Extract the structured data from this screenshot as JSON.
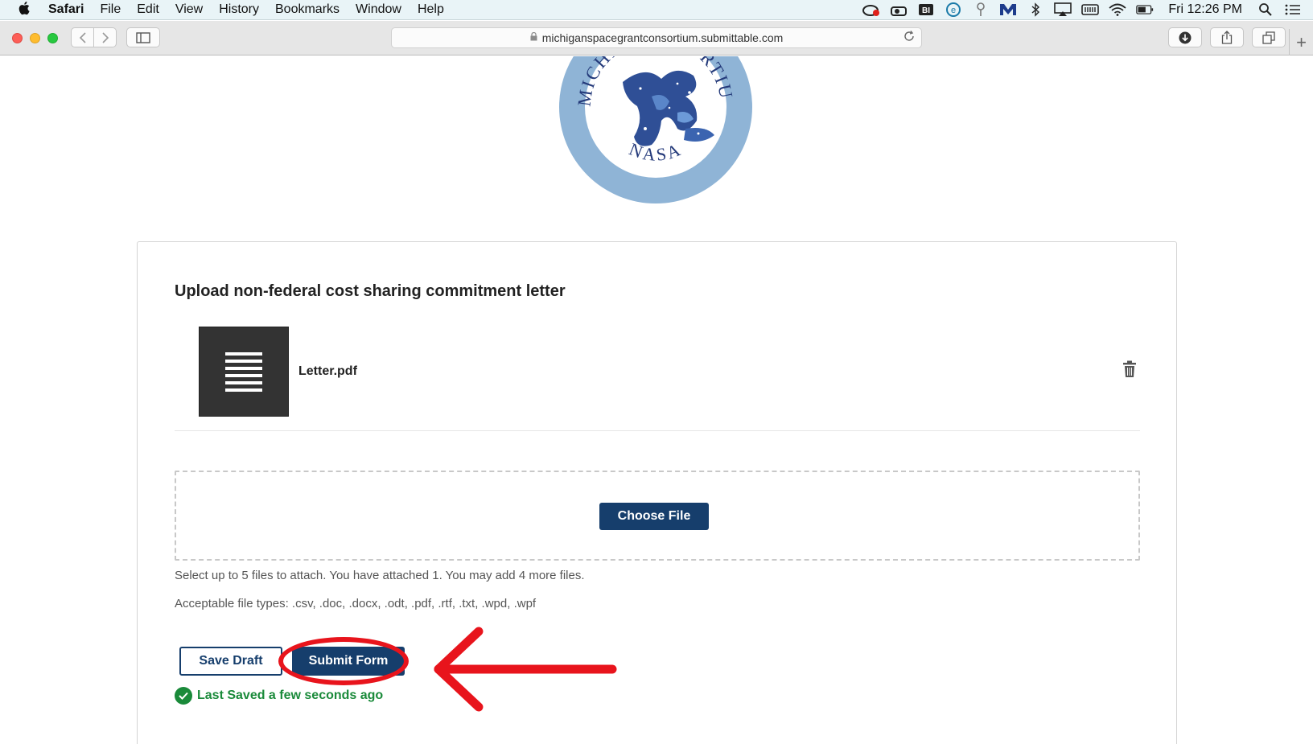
{
  "menubar": {
    "apple": "",
    "items": [
      "Safari",
      "File",
      "Edit",
      "View",
      "History",
      "Bookmarks",
      "Window",
      "Help"
    ],
    "clock": "Fri 12:26 PM",
    "status_icons": [
      "creative-cloud-icon",
      "cloud-sync-icon",
      "bi-icon",
      "e-icon",
      "key-icon",
      "m-icon",
      "bluetooth-icon",
      "airplay-icon",
      "keyboard-icon",
      "wifi-icon",
      "battery-icon",
      "spotlight-icon",
      "list-icon"
    ]
  },
  "browser": {
    "url": "michiganspacegrantconsortium.submittable.com"
  },
  "logo": {
    "top_left_text": "MICHIGA",
    "top_right_text": "SORTIUM",
    "bottom_text": "NASA"
  },
  "form": {
    "field_label": "Upload non-federal cost sharing commitment letter",
    "file_name": "Letter.pdf",
    "choose_file_label": "Choose File",
    "help_line_1": "Select up to 5 files to attach. You have attached 1. You may add 4 more files.",
    "help_line_2": "Acceptable file types: .csv, .doc, .docx, .odt, .pdf, .rtf, .txt, .wpd, .wpf",
    "save_draft_label": "Save Draft",
    "submit_label": "Submit Form",
    "saved_status": "Last Saved a few seconds ago"
  },
  "colors": {
    "primary": "#163e6c",
    "success": "#1a8a3a",
    "annotation": "#e8141c",
    "logo_ring": "#8fb4d6"
  }
}
